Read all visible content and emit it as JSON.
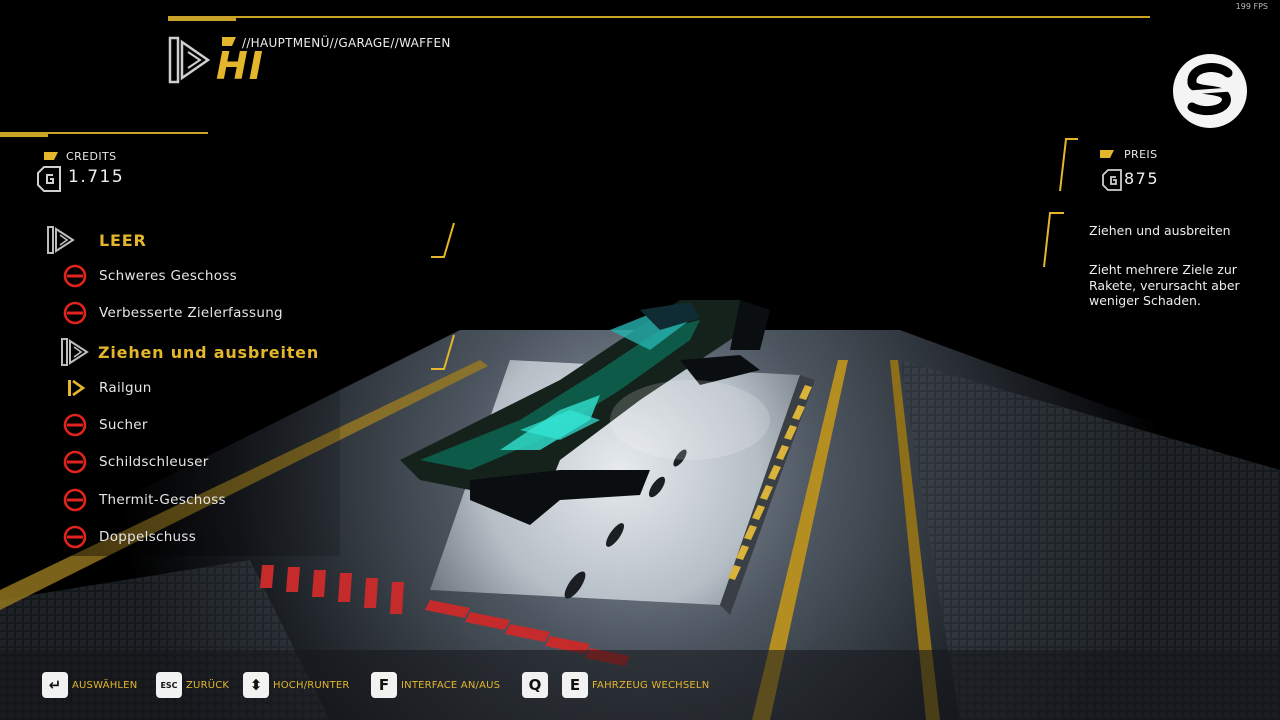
{
  "fps": "199 FPS",
  "breadcrumb": "//HAUPTMENÜ//GARAGE//WAFFEN",
  "title": "HI",
  "credits": {
    "label": "CREDITS",
    "value": "1.715"
  },
  "price": {
    "label": "PREIS",
    "value": "875"
  },
  "description": {
    "title": "Ziehen und ausbreiten",
    "body": "Zieht mehrere Ziele zur Rakete, verursacht aber weniger Schaden."
  },
  "weapons": {
    "header1": "LEER",
    "item1": "Schweres Geschoss",
    "item2": "Verbesserte Zielerfassung",
    "header2": "Ziehen und ausbreiten",
    "item3": "Railgun",
    "item4": "Sucher",
    "item5": "Schildschleuser",
    "item6": "Thermit-Geschoss",
    "item7": "Doppelschuss"
  },
  "controls": {
    "select": {
      "key": "↵",
      "label": "AUSWÄHLEN"
    },
    "back": {
      "key": "ESC",
      "label": "ZURÜCK"
    },
    "updown": {
      "key": "⬍",
      "label": "HOCH/RUNTER"
    },
    "interface": {
      "key": "F",
      "label": "INTERFACE AN/AUS"
    },
    "vehicle_q": {
      "key": "Q"
    },
    "vehicle_e": {
      "key": "E",
      "label": "FAHRZEUG WECHSELN"
    }
  },
  "colors": {
    "accent": "#e3b62b",
    "locked": "#e0231c"
  }
}
